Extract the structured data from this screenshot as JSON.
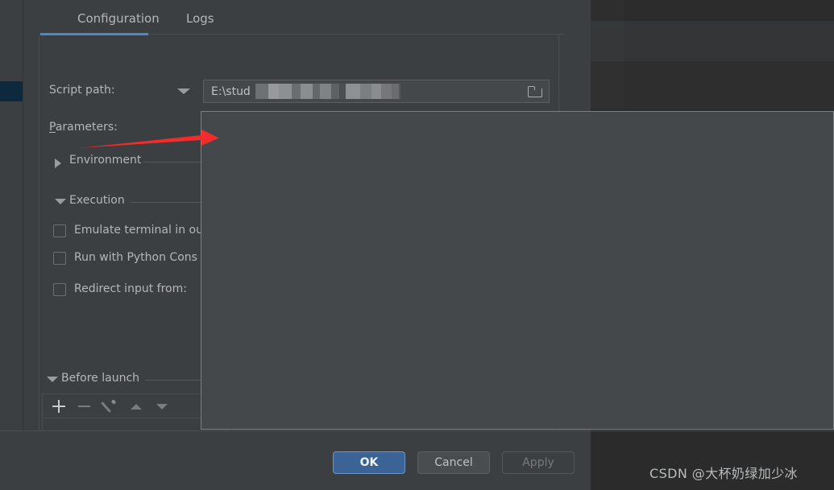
{
  "window": {
    "kind": "run-debug-configurations-dialog"
  },
  "tabs": [
    {
      "label": "Configuration",
      "active": true
    },
    {
      "label": "Logs",
      "active": false
    }
  ],
  "form": {
    "script_path": {
      "label": "Script path:",
      "value": "E:\\stud",
      "value_redacted": true,
      "browse_icon": "folder-icon",
      "dropdown_icon": "chevron-down-icon"
    },
    "parameters": {
      "label": "Parameters:",
      "value": ""
    },
    "sections": [
      {
        "id": "environment",
        "title": "Environment",
        "expanded": false,
        "twisty_icon": "chevron-right-icon"
      },
      {
        "id": "execution",
        "title": "Execution",
        "expanded": true,
        "twisty_icon": "chevron-down-icon"
      }
    ],
    "checkboxes": [
      {
        "id": "emulate-terminal",
        "label": "Emulate terminal in ou",
        "checked": false
      },
      {
        "id": "run-with-python-console",
        "label": "Run with Python Cons",
        "checked": false
      },
      {
        "id": "redirect-input-from",
        "label": "Redirect input from:",
        "checked": false
      }
    ],
    "before_launch": {
      "title": "Before launch",
      "expanded": true,
      "twisty_icon": "chevron-down-icon",
      "toolbar": [
        {
          "id": "add",
          "icon": "plus-icon",
          "enabled": true
        },
        {
          "id": "remove",
          "icon": "minus-icon",
          "enabled": false
        },
        {
          "id": "edit",
          "icon": "pencil-icon",
          "enabled": false
        },
        {
          "id": "move-up",
          "icon": "arrow-up-icon",
          "enabled": false
        },
        {
          "id": "move-down",
          "icon": "arrow-down-icon",
          "enabled": false
        }
      ]
    }
  },
  "buttons": {
    "ok": "OK",
    "cancel": "Cancel",
    "apply": "Apply"
  },
  "annotation": {
    "arrow_color": "#f22b2b",
    "points_to": "parameters-overlay-panel"
  },
  "watermark": {
    "text": "CSDN @大杯奶绿加少冰"
  },
  "colors": {
    "dialog_bg": "#3c3f41",
    "panel_bg": "#45484a",
    "ide_bg": "#2b2b2b",
    "accent_blue": "#4a88c7",
    "ok_button_blue": "#3c6395",
    "selection_blue": "#0d293e",
    "text": "#b4b7ba",
    "arrow_red": "#f22b2b"
  }
}
